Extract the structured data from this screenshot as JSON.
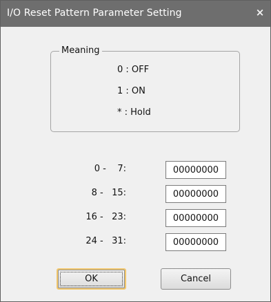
{
  "window": {
    "title": "I/O Reset Pattern Parameter Setting",
    "close_label": "×"
  },
  "meaning": {
    "legend": "Meaning",
    "lines": [
      "0 : OFF",
      "1 : ON",
      "* : Hold"
    ]
  },
  "rows": [
    {
      "label": "0 -    7:",
      "value": "00000000"
    },
    {
      "label": "8 -   15:",
      "value": "00000000"
    },
    {
      "label": "16 -   23:",
      "value": "00000000"
    },
    {
      "label": "24 -   31:",
      "value": "00000000"
    }
  ],
  "buttons": {
    "ok_label": "OK",
    "cancel_label": "Cancel"
  }
}
